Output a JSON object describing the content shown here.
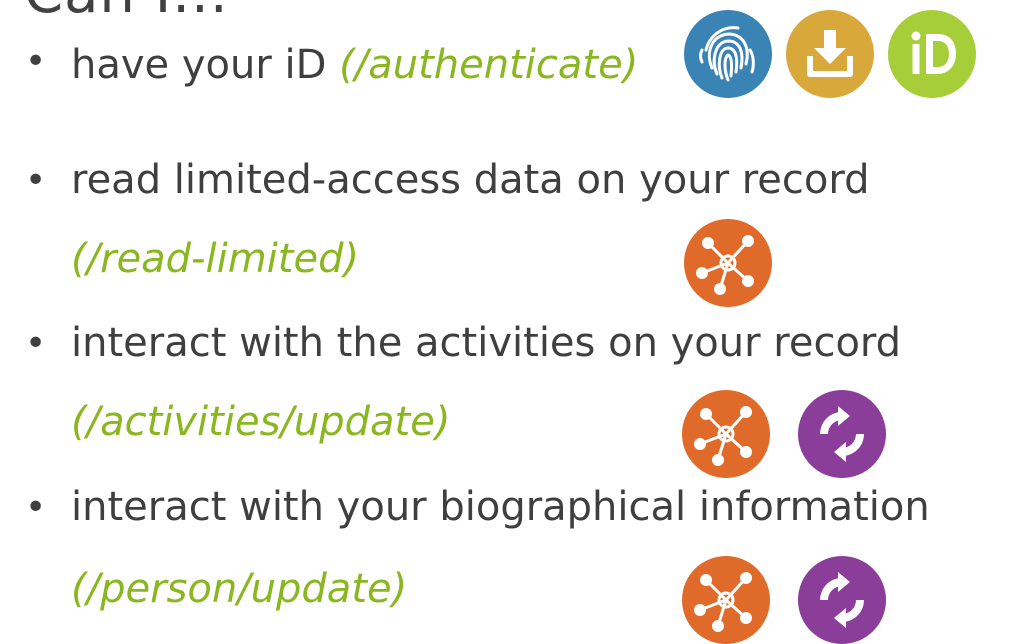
{
  "heading": "Can I...",
  "items": [
    {
      "text": "have your iD ",
      "scope": "(/authenticate)",
      "icons": [
        "fingerprint-icon",
        "download-icon",
        "orcid-id-icon"
      ]
    },
    {
      "text": "read limited-access data on your record",
      "scope": "(/read-limited)",
      "icons": [
        "network-hub-icon"
      ]
    },
    {
      "text": "interact with the activities on your record",
      "scope": "(/activities/update)",
      "icons": [
        "network-hub-icon",
        "refresh-icon"
      ]
    },
    {
      "text": "interact with your biographical information",
      "scope": "(/person/update)",
      "icons": [
        "network-hub-icon",
        "refresh-icon"
      ]
    }
  ],
  "bullet_symbol": "•",
  "colors": {
    "text": "#3f3f3f",
    "scope": "#8ab61f",
    "fingerprint": "#3a84b5",
    "download": "#d8a83a",
    "orcid": "#a6ce39",
    "hub": "#e06a2a",
    "refresh": "#8a3d99"
  }
}
